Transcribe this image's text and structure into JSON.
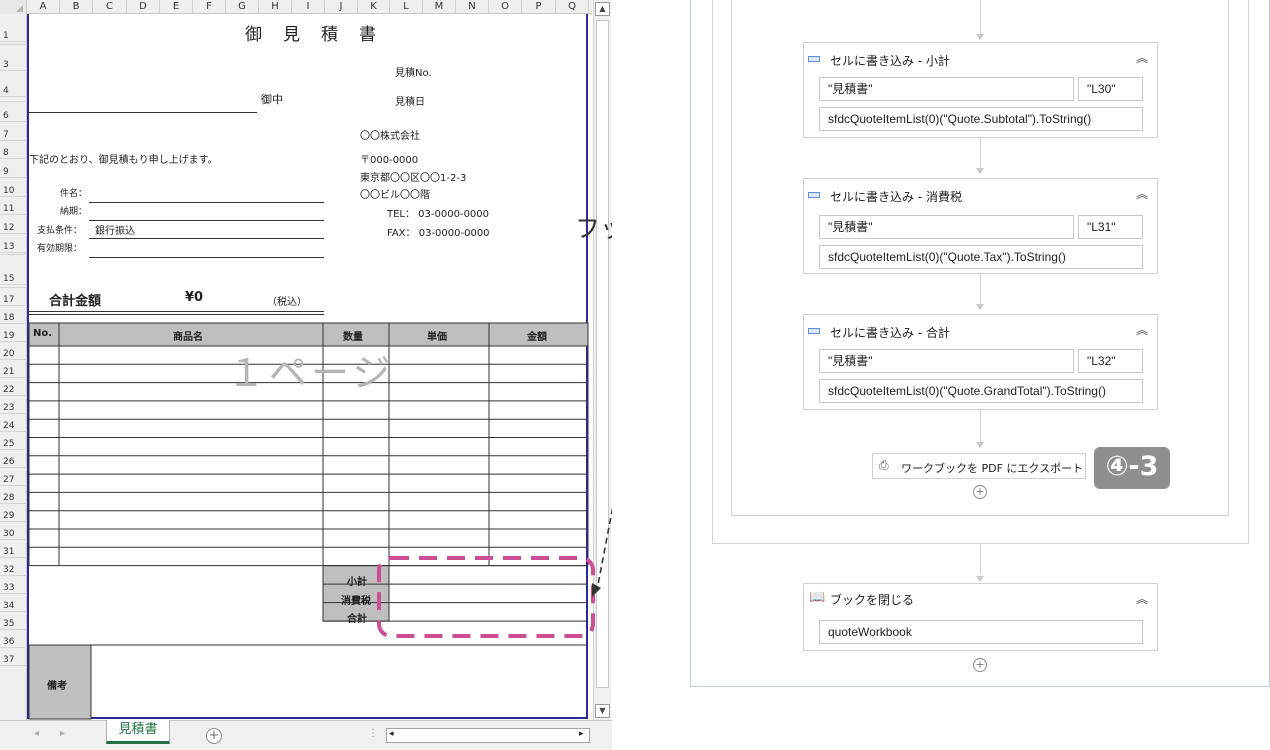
{
  "excel": {
    "columns": [
      "A",
      "B",
      "C",
      "D",
      "E",
      "F",
      "G",
      "H",
      "I",
      "J",
      "K",
      "L",
      "M",
      "N",
      "O",
      "P",
      "Q"
    ],
    "rows": [
      "1",
      "2",
      "3",
      "4",
      "5",
      "6",
      "7",
      "8",
      "9",
      "10",
      "11",
      "12",
      "13",
      "14",
      "15",
      "16",
      "17",
      "18",
      "19",
      "20",
      "21",
      "22",
      "23",
      "24",
      "25",
      "26",
      "27",
      "28",
      "29",
      "30",
      "31",
      "32",
      "33",
      "34",
      "35",
      "36",
      "37"
    ],
    "title": "御　見　積　書",
    "estimate_no_label": "見積No.",
    "onchu_label": "御中",
    "estimate_date_label": "見積日",
    "company_name": "〇〇株式会社",
    "intro_text": "下記のとおり、御見積もり申し上げます。",
    "postal": "〒000-0000",
    "address": "東京都〇〇区〇〇1-2-3",
    "building": "〇〇ビル〇〇階",
    "tel": "TEL： 03-0000-0000",
    "fax": "FAX： 03-0000-0000",
    "subject_label": "件名：",
    "delivery_label": "納期：",
    "payment_label": "支払条件：",
    "payment_value": "銀行振込",
    "validity_label": "有効期限：",
    "total_label": "合計金額",
    "total_value": "¥0",
    "tax_included": "（税込）",
    "table_headers": [
      "No.",
      "商品名",
      "数量",
      "単価",
      "金額"
    ],
    "page_watermark": "１ページ",
    "subtotal_label": "小計",
    "tax_label": "消費税",
    "grand_total_label": "合計",
    "remarks_label": "備考",
    "sheet_tab": "見積書"
  },
  "annotation": {
    "footer_edit": "フッタの編集",
    "step_badge": "④-3"
  },
  "flow": {
    "card_subtotal": {
      "title": "セルに書き込み - 小計",
      "sheet": "\"見積書\"",
      "cell": "\"L30\"",
      "value": "sfdcQuoteItemList(0)(\"Quote.Subtotal\").ToString()"
    },
    "card_tax": {
      "title": "セルに書き込み - 消費税",
      "sheet": "\"見積書\"",
      "cell": "\"L31\"",
      "value": "sfdcQuoteItemList(0)(\"Quote.Tax\").ToString()"
    },
    "card_total": {
      "title": "セルに書き込み - 合計",
      "sheet": "\"見積書\"",
      "cell": "\"L32\"",
      "value": "sfdcQuoteItemList(0)(\"Quote.GrandTotal\").ToString()"
    },
    "export_pdf": "ワークブックを PDF にエクスポート",
    "close_book": {
      "title": "ブックを閉じる",
      "value": "quoteWorkbook"
    }
  },
  "colors": {
    "page_border": "#2a2a9a",
    "header_gray": "#bfbfbf",
    "remarks_gray": "#c0c0c0",
    "dash_pink": "#cc4f94",
    "excel_green": "#217346",
    "badge_gray": "#8f8f8f"
  }
}
